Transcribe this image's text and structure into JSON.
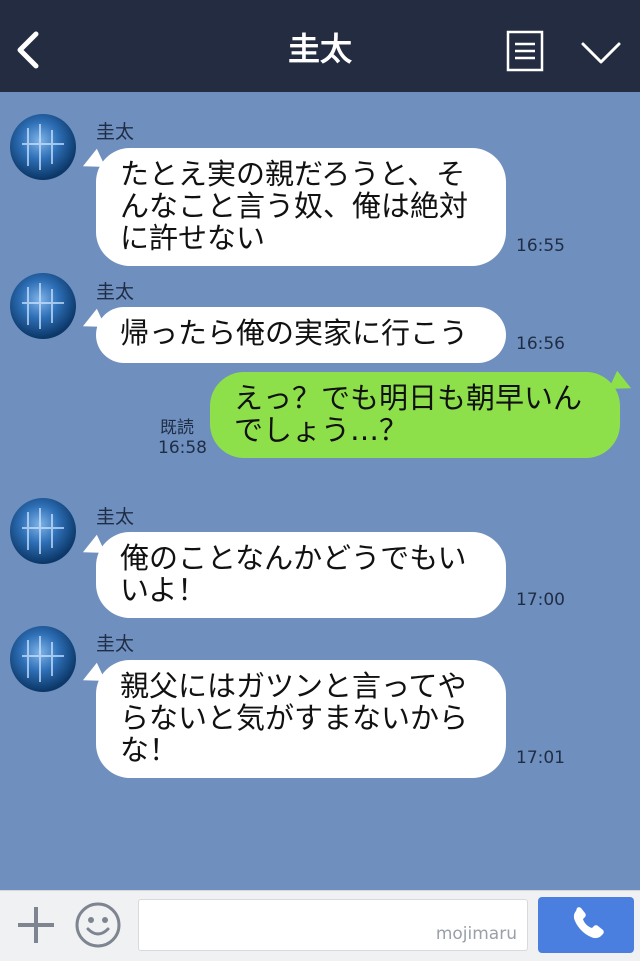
{
  "header": {
    "title": "圭太",
    "back_icon": "back-chevron-icon",
    "menu_icon": "list-menu-icon",
    "expand_icon": "chevron-down-icon"
  },
  "messages": [
    {
      "direction": "in",
      "sender": "圭太",
      "text": "たとえ実の親だろうと、そんなこと言う奴、俺は絶対に許せない",
      "time": "16:55"
    },
    {
      "direction": "in",
      "sender": "圭太",
      "text": "帰ったら俺の実家に行こう",
      "time": "16:56"
    },
    {
      "direction": "out",
      "text": "えっ？でも明日も朝早いんでしょう…？",
      "read": "既読",
      "time": "16:58"
    },
    {
      "direction": "in",
      "sender": "圭太",
      "text": "俺のことなんかどうでもいいよ！",
      "time": "17:00"
    },
    {
      "direction": "in",
      "sender": "圭太",
      "text": "親父にはガツンと言ってやらないと気がすまないからな！",
      "time": "17:01"
    }
  ],
  "footer": {
    "input_value": "",
    "watermark": "mojimaru",
    "plus_icon": "plus-icon",
    "emoji_icon": "smiley-icon",
    "call_icon": "phone-icon"
  },
  "colors": {
    "header_bg": "#232c41",
    "chat_bg": "#6f8fbf",
    "incoming_bubble": "#ffffff",
    "outgoing_bubble": "#8ee04b",
    "call_button": "#4a7fe0"
  }
}
